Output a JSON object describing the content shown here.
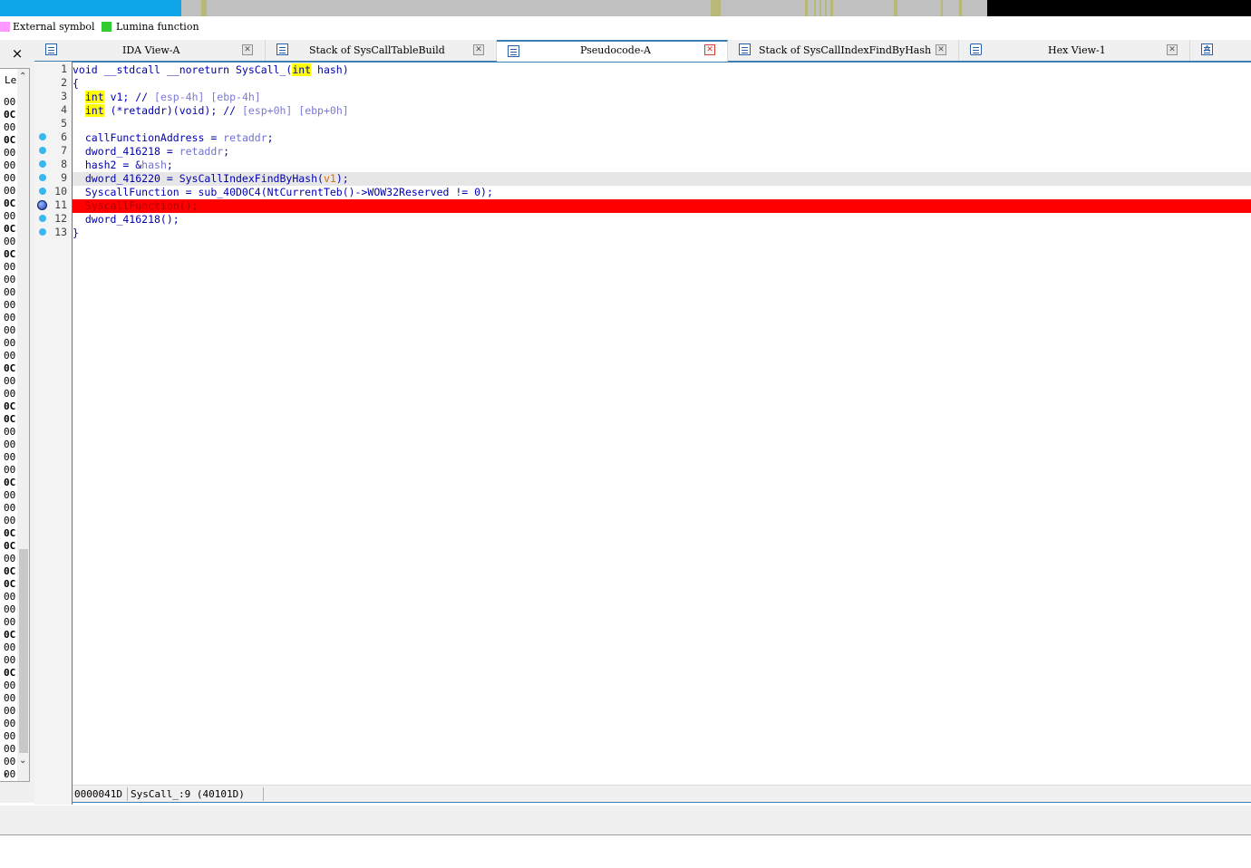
{
  "navigation_band": {
    "colors": {
      "loaded": "#0ea5e9",
      "unexplored": "#c0c0c0",
      "data": "#b8b87a",
      "end": "#000000"
    }
  },
  "legend": {
    "items": [
      {
        "label": "External symbol",
        "color": "#ff99ff"
      },
      {
        "label": "Lumina function",
        "color": "#33cc33"
      }
    ]
  },
  "left_panel": {
    "close_icon": "×",
    "header": "Le",
    "hex_values": [
      "00",
      "0C",
      "00",
      "0C",
      "00",
      "00",
      "00",
      "00",
      "0C",
      "00",
      "0C",
      "00",
      "0C",
      "00",
      "00",
      "00",
      "00",
      "00",
      "00",
      "00",
      "00",
      "0C",
      "00",
      "00",
      "0C",
      "0C",
      "00",
      "00",
      "00",
      "00",
      "0C",
      "00",
      "00",
      "00",
      "0C",
      "0C",
      "00",
      "0C",
      "0C",
      "00",
      "00",
      "00",
      "0C",
      "00",
      "00",
      "0C",
      "00",
      "00",
      "00",
      "00",
      "00",
      "00",
      "00",
      "00",
      "0C",
      "00",
      "00"
    ]
  },
  "tabs": [
    {
      "label": "IDA View-A",
      "icon": "ida-view-icon",
      "active": false
    },
    {
      "label": "Stack of SysCallTableBuild",
      "icon": "stack-icon",
      "active": false
    },
    {
      "label": "Pseudocode-A",
      "icon": "pseudocode-icon",
      "active": true
    },
    {
      "label": "Stack of SysCallIndexFindByHash",
      "icon": "stack-icon",
      "active": false
    },
    {
      "label": "Hex View-1",
      "icon": "hex-view-icon",
      "active": false
    },
    {
      "label": "A",
      "icon": "structures-icon",
      "active": false
    }
  ],
  "code": {
    "highlight_color": "#ff0000",
    "current_line_color": "#e6e6e6",
    "lines": [
      {
        "n": "1",
        "text": "void __stdcall __noreturn SysCall_(int hash)",
        "dot": false
      },
      {
        "n": "2",
        "text": "{",
        "dot": false
      },
      {
        "n": "3",
        "text": "  int v1; // [esp-4h] [ebp-4h]",
        "dot": false
      },
      {
        "n": "4",
        "text": "  int (*retaddr)(void); // [esp+0h] [ebp+0h]",
        "dot": false
      },
      {
        "n": "5",
        "text": "",
        "dot": false
      },
      {
        "n": "6",
        "text": "  callFunctionAddress = retaddr;",
        "dot": true
      },
      {
        "n": "7",
        "text": "  dword_416218 = retaddr;",
        "dot": true
      },
      {
        "n": "8",
        "text": "  hash2 = &hash;",
        "dot": true
      },
      {
        "n": "9",
        "text": "  dword_416220 = SysCallIndexFindByHash(v1);",
        "dot": true
      },
      {
        "n": "10",
        "text": "  SyscallFunction = sub_40D0C4(NtCurrentTeb()->WOW32Reserved != 0);",
        "dot": true
      },
      {
        "n": "11",
        "text": "  SyscallFunction();",
        "dot": true,
        "breakpoint": true
      },
      {
        "n": "12",
        "text": "  dword_416218();",
        "dot": true
      },
      {
        "n": "13",
        "text": "}",
        "dot": true
      }
    ]
  },
  "status": {
    "offset": "0000041D",
    "location": "SysCall_:9 (40101D)"
  }
}
